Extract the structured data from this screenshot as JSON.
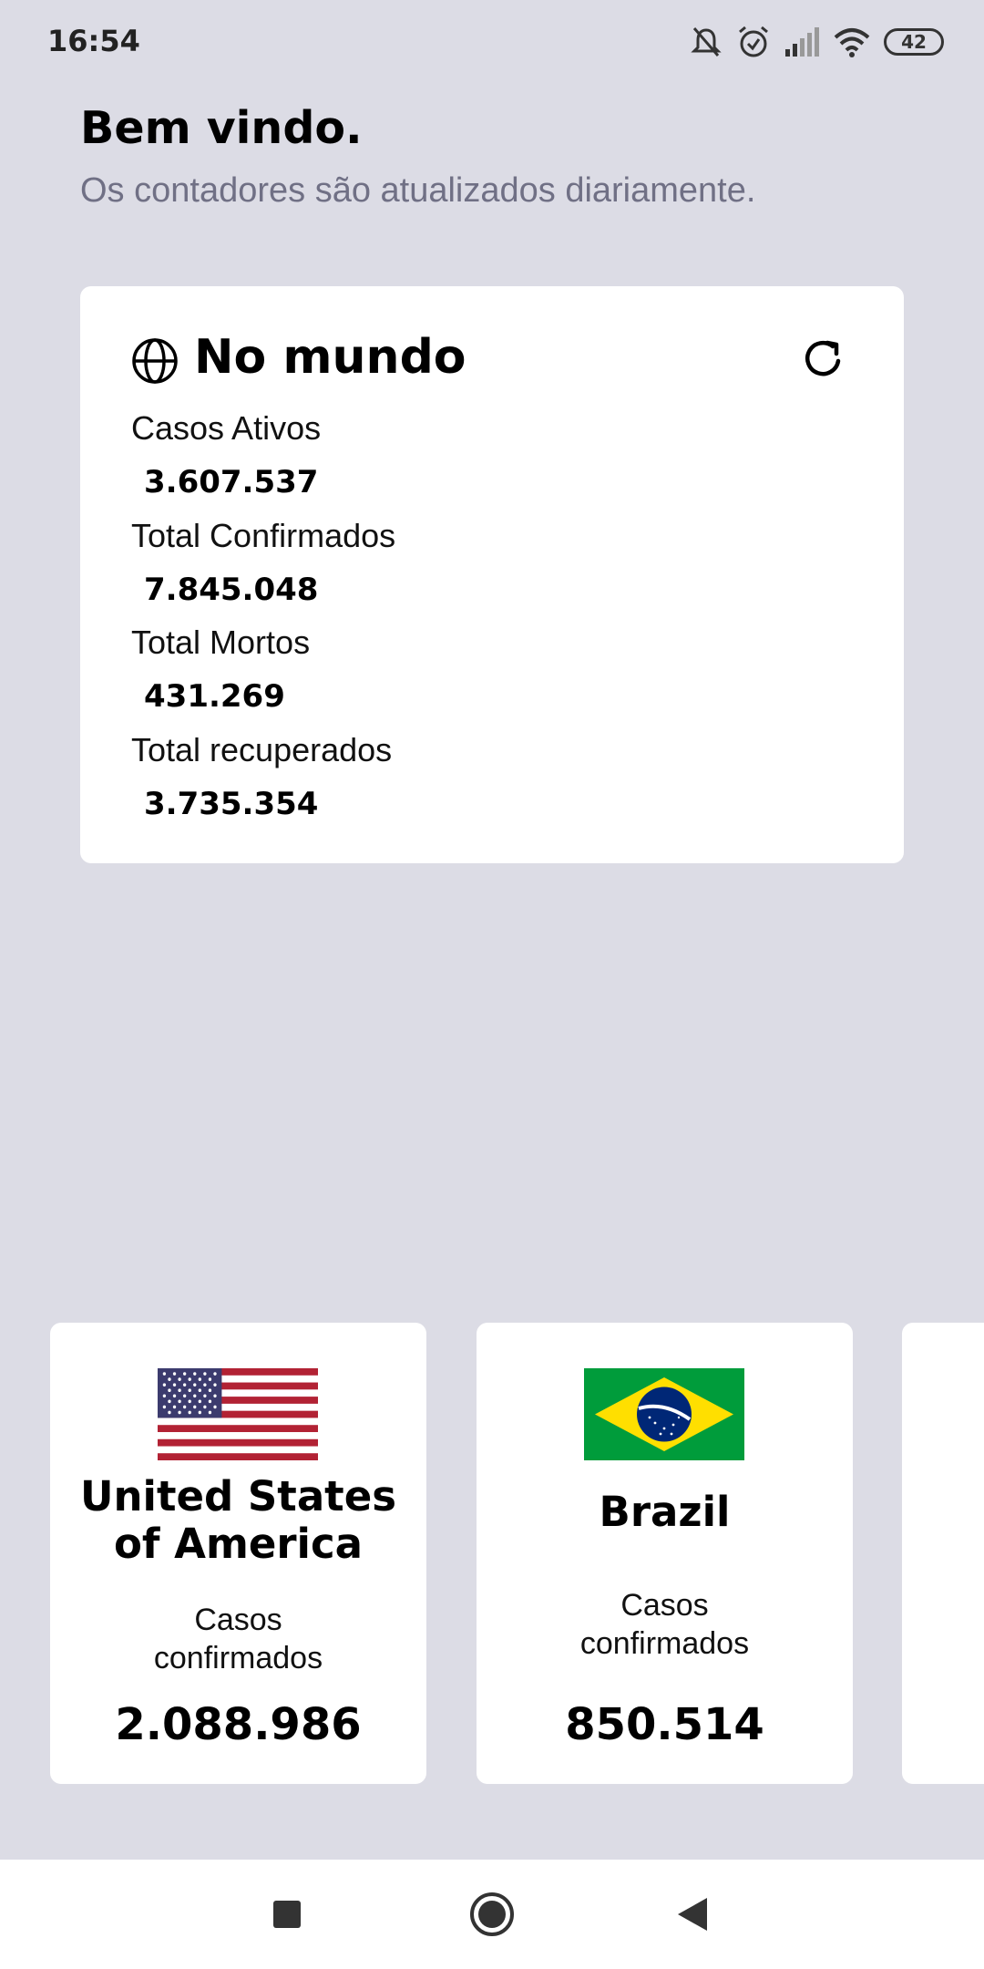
{
  "status_bar": {
    "time": "16:54",
    "battery": "42",
    "icons": [
      "mute-icon",
      "alarm-icon",
      "signal-icon",
      "wifi-icon",
      "battery-icon"
    ]
  },
  "header": {
    "title": "Bem vindo.",
    "subtitle": "Os contadores são atualizados diariamente."
  },
  "world": {
    "title": "No mundo",
    "icons": [
      "globe-icon",
      "refresh-icon"
    ],
    "stats": [
      {
        "label": "Casos Ativos",
        "value": "3.607.537"
      },
      {
        "label": "Total Confirmados",
        "value": "7.845.048"
      },
      {
        "label": "Total Mortos",
        "value": "431.269"
      },
      {
        "label": "Total recuperados",
        "value": "3.735.354"
      }
    ]
  },
  "countries": [
    {
      "name_line1": "United States",
      "name_line2": "of America",
      "cases_label_line1": "Casos",
      "cases_label_line2": "confirmados",
      "cases": "2.088.986",
      "flag": "usa-flag"
    },
    {
      "name_line1": "Brazil",
      "name_line2": "",
      "cases_label_line1": "Casos",
      "cases_label_line2": "confirmados",
      "cases": "850.514",
      "flag": "brazil-flag"
    }
  ],
  "nav": [
    "recents-square-icon",
    "home-circle-icon",
    "back-triangle-icon"
  ],
  "colors": {
    "background": "#dcdce5",
    "card": "#ffffff",
    "subtitle": "#707085",
    "usa_red": "#b22234",
    "usa_blue": "#3c3b6e",
    "brazil_green": "#009c3b",
    "brazil_yellow": "#ffdf00",
    "brazil_blue": "#002776"
  }
}
